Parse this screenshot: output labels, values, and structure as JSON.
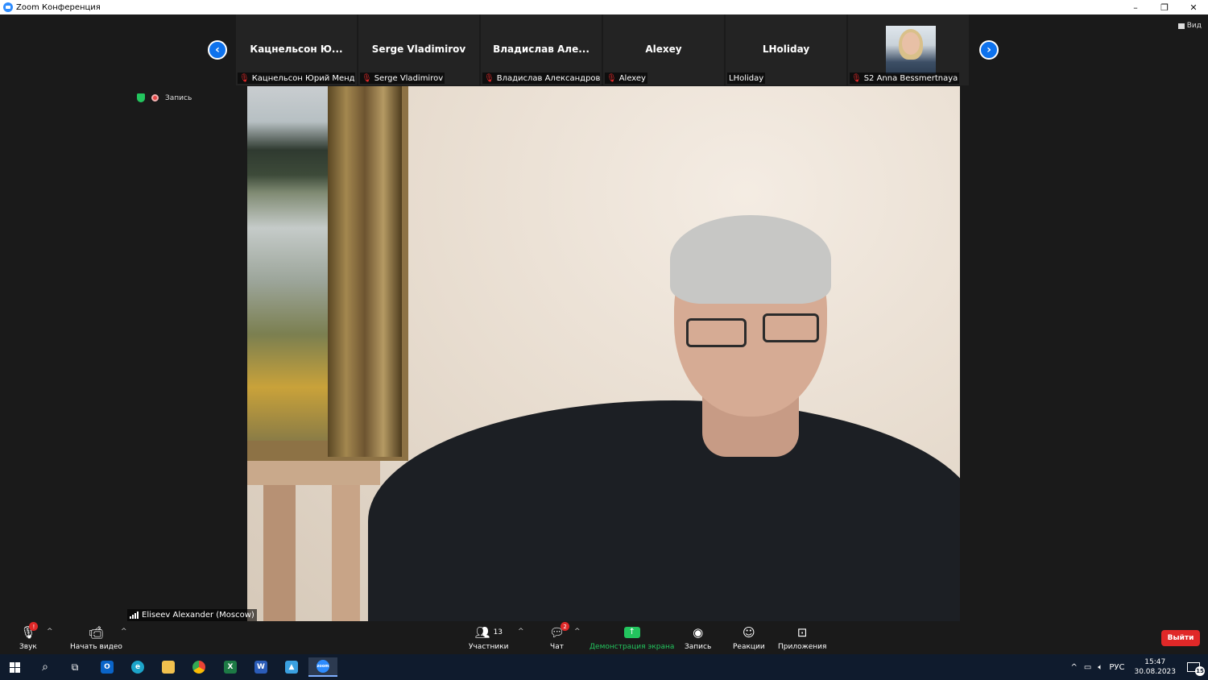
{
  "window": {
    "title": "Zoom Конференция",
    "controls": [
      "–",
      "❐",
      "✕"
    ]
  },
  "view_button": {
    "label": "Вид"
  },
  "thumbnails": [
    {
      "name": "Кацнельсон  Ю...",
      "label": "Кацнельсон Юрий Менде...",
      "muted": true
    },
    {
      "name": "Serge Vladimirov",
      "label": "Serge Vladimirov",
      "muted": true
    },
    {
      "name": "Владислав  Але...",
      "label": "Владислав Александрович...",
      "muted": true
    },
    {
      "name": "Alexey",
      "label": "Alexey",
      "muted": true
    },
    {
      "name": "LHoliday",
      "label": "LHoliday",
      "muted": false
    },
    {
      "name": "",
      "label": "S2 Anna Bessmertnaya",
      "muted": true,
      "has_photo": true
    }
  ],
  "status": {
    "recording_label": "Запись"
  },
  "speaker": {
    "name": "Eliseev Alexander (Moscow)"
  },
  "toolbar": {
    "audio": {
      "label": "Звук"
    },
    "video": {
      "label": "Начать видео"
    },
    "participants": {
      "label": "Участники",
      "count": "13"
    },
    "chat": {
      "label": "Чат",
      "badge": "2"
    },
    "share": {
      "label": "Демонстрация экрана"
    },
    "record": {
      "label": "Запись"
    },
    "reactions": {
      "label": "Реакции"
    },
    "apps": {
      "label": "Приложения"
    },
    "leave": {
      "label": "Выйти"
    }
  },
  "taskbar": {
    "apps": [
      "start",
      "search",
      "task-view",
      "outlook",
      "edge",
      "explorer",
      "chrome",
      "excel",
      "word",
      "photos",
      "zoom"
    ],
    "tray": {
      "language": "РУС",
      "time": "15:47",
      "date": "30.08.2023",
      "notifications": "15"
    }
  },
  "colors": {
    "accent": "#0e72ed",
    "share_green": "#23c55e",
    "leave_red": "#e02828",
    "background": "#1a1a1a"
  }
}
